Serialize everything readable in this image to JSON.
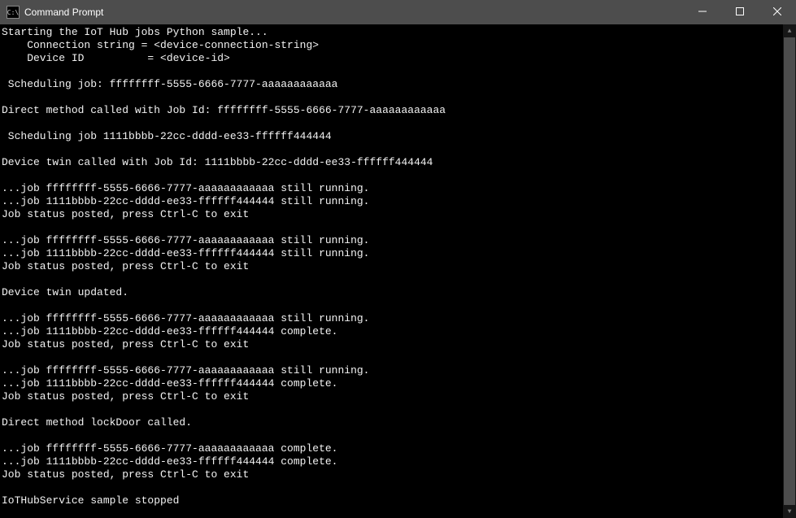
{
  "window": {
    "title": "Command Prompt",
    "icon_text": "C:\\"
  },
  "terminal": {
    "lines": [
      "Starting the IoT Hub jobs Python sample...",
      "    Connection string = <device-connection-string>",
      "    Device ID          = <device-id>",
      "",
      " Scheduling job: ffffffff-5555-6666-7777-aaaaaaaaaaaa",
      "",
      "Direct method called with Job Id: ffffffff-5555-6666-7777-aaaaaaaaaaaa",
      "",
      " Scheduling job 1111bbbb-22cc-dddd-ee33-ffffff444444",
      "",
      "Device twin called with Job Id: 1111bbbb-22cc-dddd-ee33-ffffff444444",
      "",
      "...job ffffffff-5555-6666-7777-aaaaaaaaaaaa still running.",
      "...job 1111bbbb-22cc-dddd-ee33-ffffff444444 still running.",
      "Job status posted, press Ctrl-C to exit",
      "",
      "...job ffffffff-5555-6666-7777-aaaaaaaaaaaa still running.",
      "...job 1111bbbb-22cc-dddd-ee33-ffffff444444 still running.",
      "Job status posted, press Ctrl-C to exit",
      "",
      "Device twin updated.",
      "",
      "...job ffffffff-5555-6666-7777-aaaaaaaaaaaa still running.",
      "...job 1111bbbb-22cc-dddd-ee33-ffffff444444 complete.",
      "Job status posted, press Ctrl-C to exit",
      "",
      "...job ffffffff-5555-6666-7777-aaaaaaaaaaaa still running.",
      "...job 1111bbbb-22cc-dddd-ee33-ffffff444444 complete.",
      "Job status posted, press Ctrl-C to exit",
      "",
      "Direct method lockDoor called.",
      "",
      "...job ffffffff-5555-6666-7777-aaaaaaaaaaaa complete.",
      "...job 1111bbbb-22cc-dddd-ee33-ffffff444444 complete.",
      "Job status posted, press Ctrl-C to exit",
      "",
      "IoTHubService sample stopped"
    ]
  }
}
